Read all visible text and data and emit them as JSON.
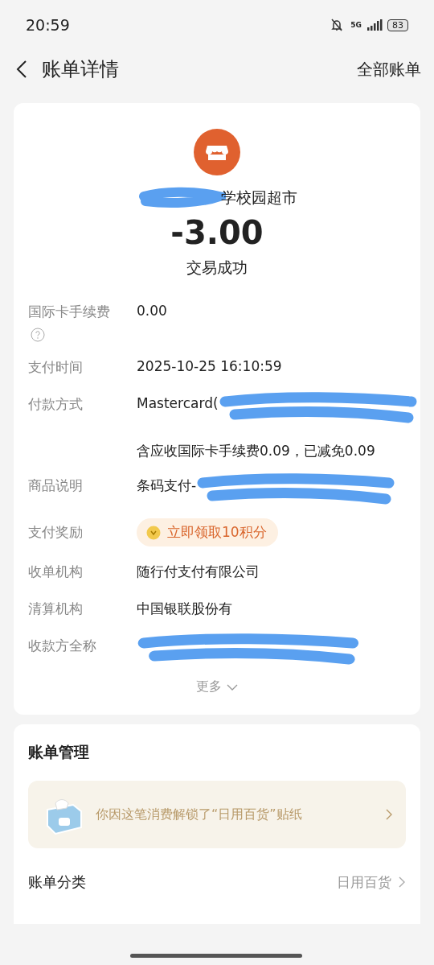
{
  "status_bar": {
    "time": "20:59",
    "network": "5G",
    "battery": "83"
  },
  "header": {
    "title": "账单详情",
    "action": "全部账单"
  },
  "summary": {
    "merchant": "学校园超市",
    "amount": "-3.00",
    "status": "交易成功"
  },
  "details": [
    {
      "kind": "text",
      "label": "国际卡手续费",
      "value": "0.00",
      "help": true
    },
    {
      "kind": "text",
      "label": "支付时间",
      "value": "2025-10-25 16:10:59",
      "help": false
    },
    {
      "kind": "text",
      "label": "付款方式",
      "value": "Mastercard(",
      "note": "含应收国际卡手续费0.09，已减免0.09",
      "redacted": true,
      "help": false
    },
    {
      "kind": "text",
      "label": "商品说明",
      "value": "条码支付-",
      "redacted": true,
      "help": false
    },
    {
      "kind": "reward",
      "label": "支付奖励",
      "value": "立即领取10积分",
      "help": false
    },
    {
      "kind": "text",
      "label": "收单机构",
      "value": "随行付支付有限公司",
      "help": false
    },
    {
      "kind": "text",
      "label": "清算机构",
      "value": "中国银联股份有",
      "help": false
    },
    {
      "kind": "text",
      "label": "收款方全称",
      "redacted": true,
      "help": false
    }
  ],
  "more": "更多",
  "management": {
    "title": "账单管理",
    "banner": "你因这笔消费解锁了“日用百货”贴纸",
    "rows": [
      {
        "label": "账单分类",
        "value": "日用百货"
      }
    ]
  }
}
